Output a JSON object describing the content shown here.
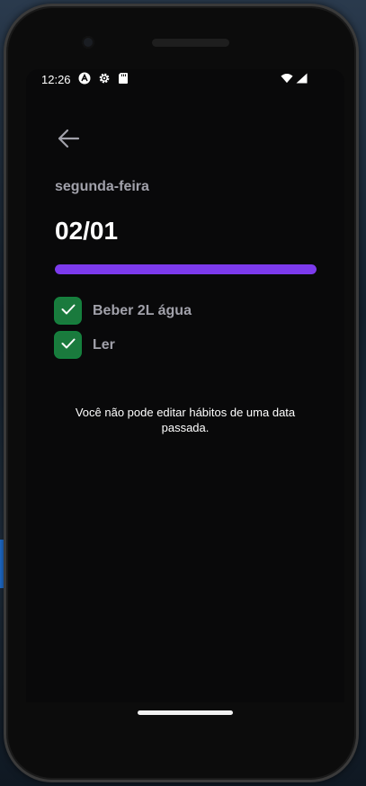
{
  "status_bar": {
    "time": "12:26",
    "icons": [
      "app-notification-icon",
      "settings-gear-icon",
      "sd-card-icon",
      "wifi-icon",
      "signal-icon"
    ]
  },
  "header": {
    "back_icon": "arrow-left-icon",
    "weekday": "segunda-feira",
    "date": "02/01"
  },
  "progress": {
    "percent": 100,
    "color": "#7c3aed"
  },
  "habits": [
    {
      "label": "Beber 2L água",
      "checked": true
    },
    {
      "label": "Ler",
      "checked": true
    }
  ],
  "notice": {
    "line1": "Você não pode editar hábitos de uma data",
    "line2": "passada."
  },
  "colors": {
    "background": "#09090a",
    "checkbox": "#1a7a3d",
    "muted_text": "#a1a1aa"
  }
}
